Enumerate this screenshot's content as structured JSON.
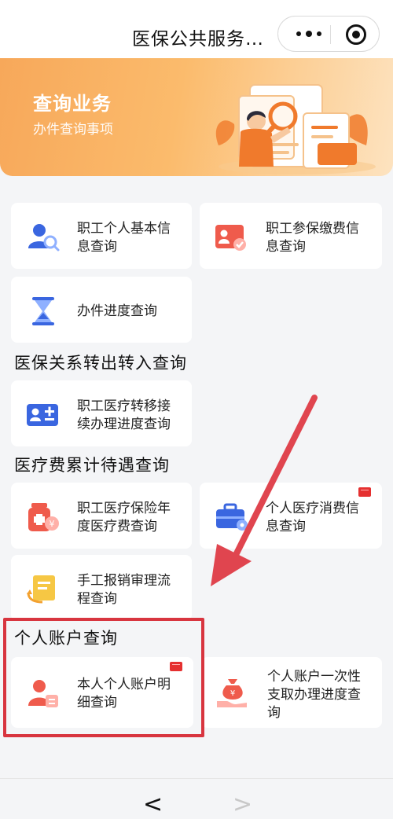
{
  "header": {
    "title": "医保公共服务…"
  },
  "banner": {
    "title": "查询业务",
    "subtitle": "办件查询事项"
  },
  "items": {
    "basic_info": "职工个人基本信息查询",
    "insurance_payment": "职工参保缴费信息查询",
    "progress": "办件进度查询",
    "transfer_progress": "职工医疗转移接续办理进度查询",
    "annual_medical": "职工医疗保险年度医疗费查询",
    "consumption": "个人医疗消费信息查询",
    "reimbursement": "手工报销审理流程查询",
    "account_detail": "本人个人账户明细查询",
    "one_time_withdraw": "个人账户一次性支取办理进度查询"
  },
  "sections": {
    "transfer": "医保关系转出转入查询",
    "cost": "医疗费累计待遇查询",
    "account": "个人账户查询"
  },
  "nav": {
    "back": "<",
    "forward": ">"
  },
  "colors": {
    "banner_orange": "#f7a85a",
    "highlight_red": "#d8353f",
    "arrow_red": "#e0454f",
    "icon_blue": "#3a66e0",
    "icon_red": "#ef5b4c"
  }
}
